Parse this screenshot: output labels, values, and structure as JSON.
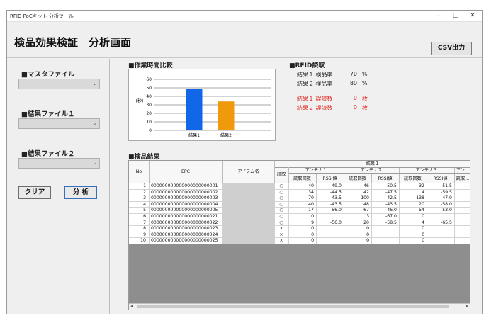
{
  "window": {
    "title": "RFID PoCキット 分析ツール",
    "minimize": "–",
    "maximize": "□",
    "close": "✕"
  },
  "header": {
    "page_title": "検品効果検証　分析画面",
    "csv_button": "CSV出力"
  },
  "sidebar": {
    "master_label": "■マスタファイル",
    "result1_label": "■結果ファイル１",
    "result2_label": "■結果ファイル２",
    "chevron_icon": "chevron-down-icon",
    "clear_button": "クリア",
    "analyze_button": "分 析"
  },
  "chart_section": {
    "label": "■作業時間比較"
  },
  "chart_data": {
    "type": "bar",
    "categories": [
      "結果1",
      "結果2"
    ],
    "values": [
      49,
      34
    ],
    "colors": [
      "#1266e8",
      "#ee9a0c"
    ],
    "ylabel": "(秒)",
    "ylim": [
      0,
      60
    ],
    "yticks": [
      "0",
      "10",
      "20",
      "30",
      "40",
      "50",
      "60"
    ],
    "grid": true
  },
  "rfid": {
    "label": "■RFID読取",
    "rows": [
      {
        "name": "結果１ 検品率",
        "value": "70",
        "unit": "%",
        "error": false
      },
      {
        "name": "結果２ 検品率",
        "value": "80",
        "unit": "%",
        "error": false
      },
      {
        "name": "結果１ 誤読数",
        "value": "0",
        "unit": "枚",
        "error": true
      },
      {
        "name": "結果２ 誤読数",
        "value": "0",
        "unit": "枚",
        "error": true
      }
    ]
  },
  "table_section": {
    "label": "■検品結果"
  },
  "table": {
    "header_no": "No",
    "header_epc": "EPC",
    "header_item": "アイテム名",
    "header_result_group": "結果１",
    "header_read": "読取",
    "antennas": [
      "アンテナ１",
      "アンテナ２",
      "アンテナ３",
      "アン…"
    ],
    "sub_count": "読取回数",
    "sub_rssi": "RSSI値",
    "sub_count_cut": "読取…",
    "rows": [
      {
        "no": "1",
        "epc": "000000000000000000000001",
        "read": "○",
        "a1c": "40",
        "a1r": "-49.0",
        "a2c": "46",
        "a2r": "-50.5",
        "a3c": "32",
        "a3r": "-51.5"
      },
      {
        "no": "2",
        "epc": "000000000000000000000002",
        "read": "○",
        "a1c": "34",
        "a1r": "-44.5",
        "a2c": "42",
        "a2r": "-47.5",
        "a3c": "4",
        "a3r": "-59.5"
      },
      {
        "no": "3",
        "epc": "000000000000000000000003",
        "read": "○",
        "a1c": "70",
        "a1r": "-43.5",
        "a2c": "100",
        "a2r": "-42.5",
        "a3c": "138",
        "a3r": "-47.0"
      },
      {
        "no": "4",
        "epc": "000000000000000000000004",
        "read": "○",
        "a1c": "40",
        "a1r": "-43.5",
        "a2c": "48",
        "a2r": "-43.5",
        "a3c": "20",
        "a3r": "-58.0"
      },
      {
        "no": "5",
        "epc": "000000000000000000000005",
        "read": "○",
        "a1c": "17",
        "a1r": "-56.0",
        "a2c": "67",
        "a2r": "-46.0",
        "a3c": "54",
        "a3r": "-53.0"
      },
      {
        "no": "6",
        "epc": "000000000000000000000021",
        "read": "○",
        "a1c": "0",
        "a1r": "",
        "a2c": "3",
        "a2r": "-67.0",
        "a3c": "0",
        "a3r": ""
      },
      {
        "no": "7",
        "epc": "000000000000000000000022",
        "read": "○",
        "a1c": "9",
        "a1r": "-56.0",
        "a2c": "20",
        "a2r": "-58.5",
        "a3c": "4",
        "a3r": "-65.5"
      },
      {
        "no": "8",
        "epc": "000000000000000000000023",
        "read": "×",
        "a1c": "0",
        "a1r": "",
        "a2c": "0",
        "a2r": "",
        "a3c": "0",
        "a3r": ""
      },
      {
        "no": "9",
        "epc": "000000000000000000000024",
        "read": "×",
        "a1c": "0",
        "a1r": "",
        "a2c": "0",
        "a2r": "",
        "a3c": "0",
        "a3r": ""
      },
      {
        "no": "10",
        "epc": "000000000000000000000025",
        "read": "×",
        "a1c": "0",
        "a1r": "",
        "a2c": "0",
        "a2r": "",
        "a3c": "0",
        "a3r": ""
      }
    ],
    "scroll_left": "◂",
    "scroll_right": "▸"
  }
}
